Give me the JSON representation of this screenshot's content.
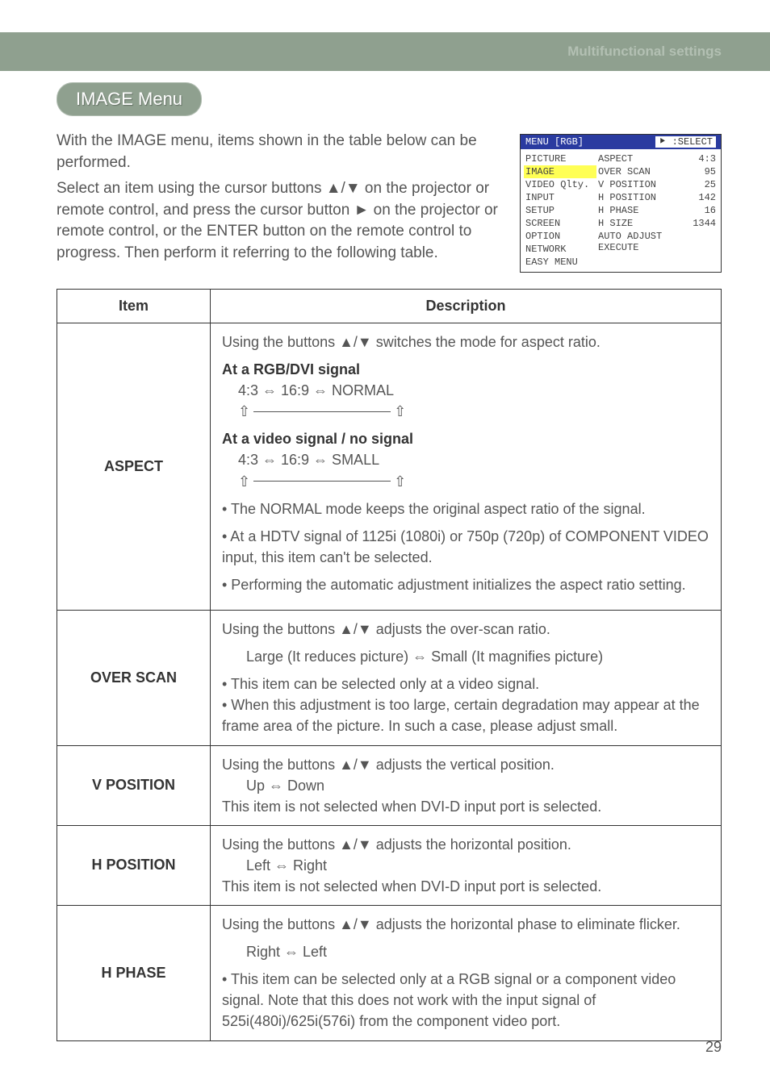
{
  "header": {
    "section": "Multifunctional settings"
  },
  "menuPill": "IMAGE Menu",
  "intro": {
    "p1": "With the IMAGE menu, items shown in the table below can be performed.",
    "p2": "Select an item using the cursor buttons ▲/▼ on the projector or remote control, and press the cursor button ► on the projector or remote control, or the ENTER button on the remote control to progress. Then perform it referring to the following table."
  },
  "osd": {
    "title": "MENU [RGB]",
    "select": "⯈ :SELECT",
    "left": [
      "PICTURE",
      "IMAGE",
      "VIDEO Qlty.",
      "INPUT",
      "SETUP",
      "SCREEN",
      "OPTION",
      "NETWORK",
      "EASY MENU"
    ],
    "mid": [
      "ASPECT",
      "OVER SCAN",
      "V POSITION",
      "H POSITION",
      "H PHASE",
      "H SIZE",
      "AUTO ADJUST EXECUTE"
    ],
    "right": [
      "4:3",
      "95",
      "25",
      "142",
      "16",
      "1344",
      ""
    ]
  },
  "columns": {
    "item": "Item",
    "desc": "Description"
  },
  "rows": [
    {
      "item": "ASPECT",
      "lines": {
        "l1": "Using the buttons ▲/▼ switches the mode for aspect ratio.",
        "h1": "At a RGB/DVI signal",
        "v1": "4:3 ⇔ 16:9 ⇔ NORMAL",
        "h2": "At a video signal / no signal",
        "v2": "4:3 ⇔ 16:9 ⇔ SMALL",
        "n1": "• The NORMAL mode keeps the original aspect ratio of the signal.",
        "n2": "• At a HDTV signal of 1125i (1080i) or 750p (720p) of COMPONENT VIDEO input, this item can't be selected.",
        "n3": "• Performing the automatic adjustment initializes the aspect ratio setting."
      }
    },
    {
      "item": "OVER SCAN",
      "lines": {
        "l1": "Using the buttons ▲/▼ adjusts the over-scan ratio.",
        "v1": "Large (It reduces picture) ⇔ Small (It magnifies picture)",
        "n1": "• This item can be selected only at a video signal.",
        "n2": "• When this adjustment is too large, certain degradation may appear at the frame area of the picture. In such a case, please adjust small."
      }
    },
    {
      "item": "V POSITION",
      "lines": {
        "l1": "Using the buttons ▲/▼ adjusts the vertical position.",
        "v1": "Up ⇔ Down",
        "n1": "This item is not selected when DVI-D input port is selected."
      }
    },
    {
      "item": "H POSITION",
      "lines": {
        "l1": "Using the buttons ▲/▼ adjusts the horizontal position.",
        "v1": "Left ⇔ Right",
        "n1": "This item is not selected when DVI-D input port is selected."
      }
    },
    {
      "item": "H PHASE",
      "lines": {
        "l1": "Using the buttons ▲/▼ adjusts the horizontal phase to eliminate flicker.",
        "v1": "Right ⇔ Left",
        "n1": "• This item can be selected only at a RGB signal or a component video signal. Note that this does not work with the input signal of 525i(480i)/625i(576i) from the component video port."
      }
    }
  ],
  "pageNumber": "29"
}
